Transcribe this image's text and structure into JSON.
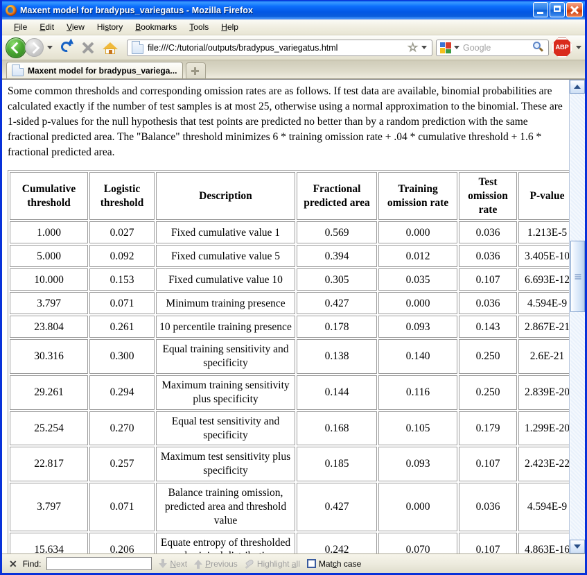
{
  "window": {
    "title": "Maxent model for bradypus_variegatus - Mozilla Firefox",
    "minimize_label": "Minimize",
    "maximize_label": "Maximize",
    "close_label": "Close"
  },
  "menubar": {
    "items": [
      {
        "label": "File",
        "accesskey": "F"
      },
      {
        "label": "Edit",
        "accesskey": "E"
      },
      {
        "label": "View",
        "accesskey": "V"
      },
      {
        "label": "History",
        "accesskey": "s"
      },
      {
        "label": "Bookmarks",
        "accesskey": "B"
      },
      {
        "label": "Tools",
        "accesskey": "T"
      },
      {
        "label": "Help",
        "accesskey": "H"
      }
    ]
  },
  "toolbar": {
    "back_label": "Back",
    "forward_label": "Forward",
    "reload_label": "Reload",
    "stop_label": "Stop",
    "home_label": "Home",
    "url": "file:///C:/tutorial/outputs/bradypus_variegatus.html",
    "bookmark_label": "Bookmark this page",
    "search_placeholder": "Google",
    "search_value": "",
    "search_engine": "Google",
    "adblock_label": "ABP"
  },
  "tabs": [
    {
      "label": "Maxent model for bradypus_variega...",
      "active": true
    }
  ],
  "newtab_label": "Open a new tab",
  "content": {
    "intro": "Some common thresholds and corresponding omission rates are as follows. If test data are available, binomial probabilities are calculated exactly if the number of test samples is at most 25, otherwise using a normal approximation to the binomial. These are 1-sided p-values for the null hypothesis that test points are predicted no better than by a random prediction with the same fractional predicted area. The \"Balance\" threshold minimizes 6 * training omission rate + .04 * cumulative threshold + 1.6 * fractional predicted area.",
    "table": {
      "headers": [
        "Cumulative threshold",
        "Logistic threshold",
        "Description",
        "Fractional predicted area",
        "Training omission rate",
        "Test omission rate",
        "P-value"
      ],
      "rows": [
        [
          "1.000",
          "0.027",
          "Fixed cumulative value 1",
          "0.569",
          "0.000",
          "0.036",
          "1.213E-5"
        ],
        [
          "5.000",
          "0.092",
          "Fixed cumulative value 5",
          "0.394",
          "0.012",
          "0.036",
          "3.405E-10"
        ],
        [
          "10.000",
          "0.153",
          "Fixed cumulative value 10",
          "0.305",
          "0.035",
          "0.107",
          "6.693E-12"
        ],
        [
          "3.797",
          "0.071",
          "Minimum training presence",
          "0.427",
          "0.000",
          "0.036",
          "4.594E-9"
        ],
        [
          "23.804",
          "0.261",
          "10 percentile training presence",
          "0.178",
          "0.093",
          "0.143",
          "2.867E-21"
        ],
        [
          "30.316",
          "0.300",
          "Equal training sensitivity and specificity",
          "0.138",
          "0.140",
          "0.250",
          "2.6E-21"
        ],
        [
          "29.261",
          "0.294",
          "Maximum training sensitivity plus specificity",
          "0.144",
          "0.116",
          "0.250",
          "2.839E-20"
        ],
        [
          "25.254",
          "0.270",
          "Equal test sensitivity and specificity",
          "0.168",
          "0.105",
          "0.179",
          "1.299E-20"
        ],
        [
          "22.817",
          "0.257",
          "Maximum test sensitivity plus specificity",
          "0.185",
          "0.093",
          "0.107",
          "2.423E-22"
        ],
        [
          "3.797",
          "0.071",
          "Balance training omission, predicted area and threshold value",
          "0.427",
          "0.000",
          "0.036",
          "4.594E-9"
        ],
        [
          "15.634",
          "0.206",
          "Equate entropy of thresholded and original distributions",
          "0.242",
          "0.070",
          "0.107",
          "4.863E-16"
        ]
      ]
    }
  },
  "scrollbar": {
    "up_label": "Scroll up",
    "down_label": "Scroll down",
    "thumb_top_pct": 33,
    "thumb_height_pct": 16
  },
  "findbar": {
    "close_label": "✕",
    "label": "Find:",
    "value": "",
    "next_label": "Next",
    "previous_label": "Previous",
    "highlight_label": "Highlight all",
    "matchcase_label": "Match case",
    "matchcase_checked": false
  }
}
